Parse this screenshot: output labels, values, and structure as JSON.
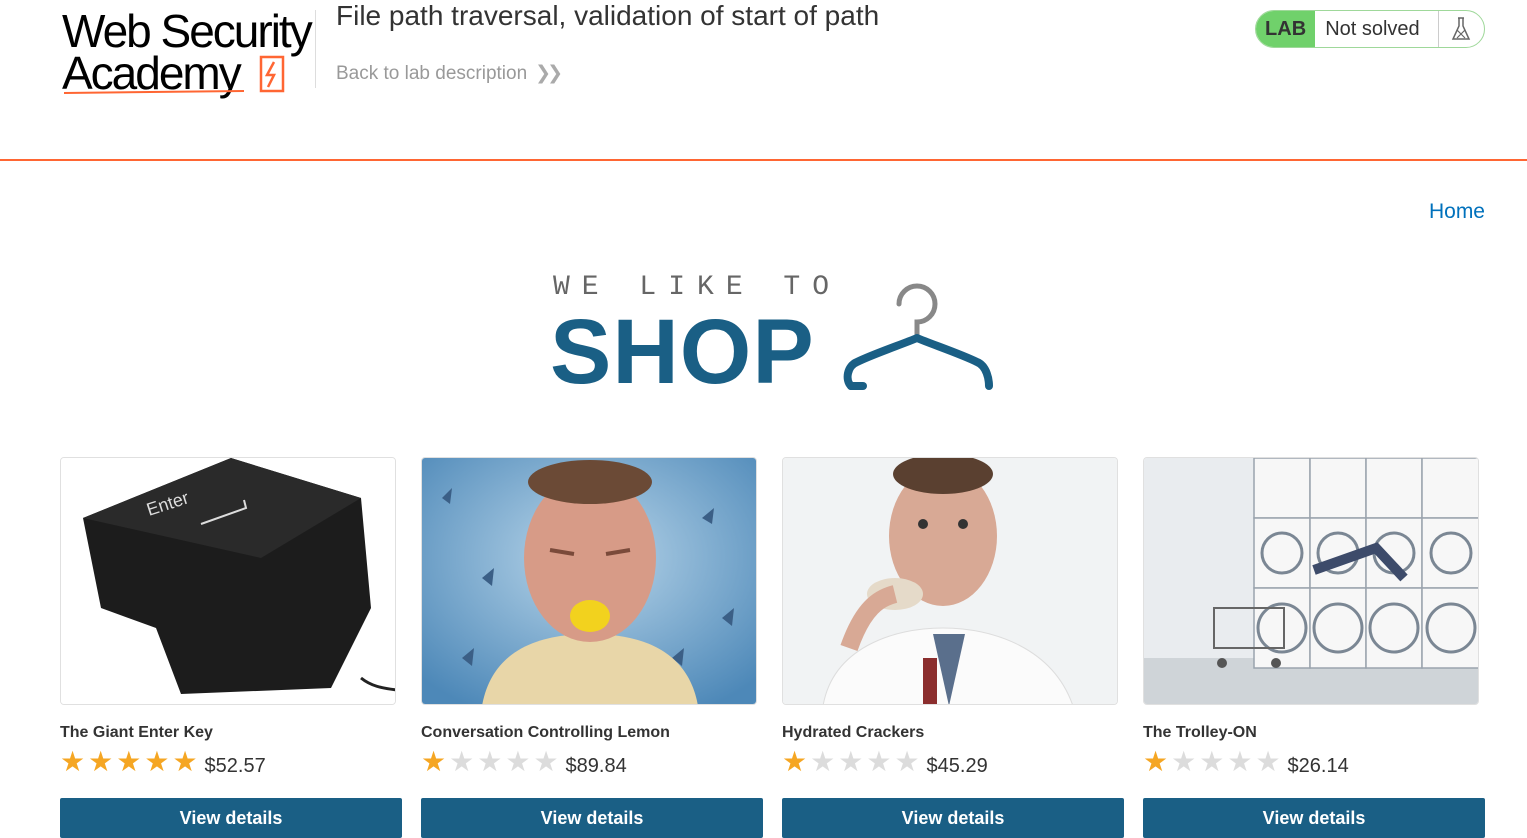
{
  "header": {
    "logo_line1": "Web Security",
    "logo_line2": "Academy",
    "lab_title": "File path traversal, validation of start of path",
    "back_link": "Back to lab description",
    "status_badge": "LAB",
    "status_text": "Not solved"
  },
  "nav": {
    "home": "Home"
  },
  "banner": {
    "tagline": "WE LIKE TO",
    "title": "SHOP"
  },
  "colors": {
    "accent": "#ff6633",
    "brand": "#1a5f85",
    "link": "#0071bc",
    "lab_green": "#70d16b",
    "star": "#f5a623"
  },
  "products": [
    {
      "name": "The Giant Enter Key",
      "rating": 5,
      "price": "$52.57",
      "button": "View details"
    },
    {
      "name": "Conversation Controlling Lemon",
      "rating": 1,
      "price": "$89.84",
      "button": "View details"
    },
    {
      "name": "Hydrated Crackers",
      "rating": 1,
      "price": "$45.29",
      "button": "View details"
    },
    {
      "name": "The Trolley-ON",
      "rating": 1,
      "price": "$26.14",
      "button": "View details"
    }
  ]
}
